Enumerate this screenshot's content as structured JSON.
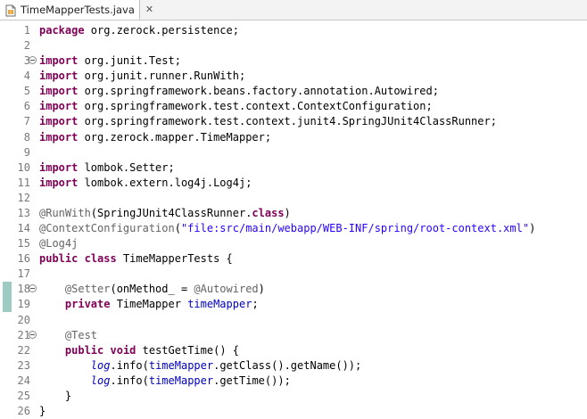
{
  "tab": {
    "title": "TimeMapperTests.java"
  },
  "lines": [
    {
      "n": "1",
      "tokens": [
        {
          "t": "package",
          "c": "kw"
        },
        {
          "t": " org.zerock.persistence;"
        }
      ]
    },
    {
      "n": "2",
      "tokens": []
    },
    {
      "n": "3",
      "fold": true,
      "tokens": [
        {
          "t": "import",
          "c": "kw"
        },
        {
          "t": " org.junit.Test;"
        }
      ]
    },
    {
      "n": "4",
      "tokens": [
        {
          "t": "import",
          "c": "kw"
        },
        {
          "t": " org.junit.runner.RunWith;"
        }
      ]
    },
    {
      "n": "5",
      "tokens": [
        {
          "t": "import",
          "c": "kw"
        },
        {
          "t": " org.springframework.beans.factory.annotation.Autowired;"
        }
      ]
    },
    {
      "n": "6",
      "tokens": [
        {
          "t": "import",
          "c": "kw"
        },
        {
          "t": " org.springframework.test.context.ContextConfiguration;"
        }
      ]
    },
    {
      "n": "7",
      "tokens": [
        {
          "t": "import",
          "c": "kw"
        },
        {
          "t": " org.springframework.test.context.junit4.SpringJUnit4ClassRunner;"
        }
      ]
    },
    {
      "n": "8",
      "tokens": [
        {
          "t": "import",
          "c": "kw"
        },
        {
          "t": " org.zerock.mapper.TimeMapper;"
        }
      ]
    },
    {
      "n": "9",
      "tokens": []
    },
    {
      "n": "10",
      "tokens": [
        {
          "t": "import",
          "c": "kw"
        },
        {
          "t": " lombok.Setter;"
        }
      ]
    },
    {
      "n": "11",
      "tokens": [
        {
          "t": "import",
          "c": "kw"
        },
        {
          "t": " lombok.extern.log4j.Log4j;"
        }
      ]
    },
    {
      "n": "12",
      "tokens": []
    },
    {
      "n": "13",
      "tokens": [
        {
          "t": "@RunWith",
          "c": "ann"
        },
        {
          "t": "(SpringJUnit4ClassRunner."
        },
        {
          "t": "class",
          "c": "kw"
        },
        {
          "t": ")"
        }
      ]
    },
    {
      "n": "14",
      "tokens": [
        {
          "t": "@ContextConfiguration",
          "c": "ann"
        },
        {
          "t": "("
        },
        {
          "t": "\"file:src/main/webapp/WEB-INF/spring/root-context.xml\"",
          "c": "str"
        },
        {
          "t": ")"
        }
      ]
    },
    {
      "n": "15",
      "tokens": [
        {
          "t": "@Log4j",
          "c": "ann"
        }
      ]
    },
    {
      "n": "16",
      "tokens": [
        {
          "t": "public",
          "c": "kw"
        },
        {
          "t": " "
        },
        {
          "t": "class",
          "c": "kw"
        },
        {
          "t": " TimeMapperTests {"
        }
      ]
    },
    {
      "n": "17",
      "tokens": []
    },
    {
      "n": "18",
      "fold": true,
      "mark": true,
      "tokens": [
        {
          "t": "    "
        },
        {
          "t": "@Setter",
          "c": "ann"
        },
        {
          "t": "(onMethod_ = "
        },
        {
          "t": "@Autowired",
          "c": "ann"
        },
        {
          "t": ")"
        }
      ]
    },
    {
      "n": "19",
      "mark": true,
      "tokens": [
        {
          "t": "    "
        },
        {
          "t": "private",
          "c": "kw"
        },
        {
          "t": " TimeMapper "
        },
        {
          "t": "timeMapper",
          "c": "fld"
        },
        {
          "t": ";"
        }
      ]
    },
    {
      "n": "20",
      "tokens": []
    },
    {
      "n": "21",
      "fold": true,
      "tokens": [
        {
          "t": "    "
        },
        {
          "t": "@Test",
          "c": "ann"
        }
      ]
    },
    {
      "n": "22",
      "tokens": [
        {
          "t": "    "
        },
        {
          "t": "public",
          "c": "kw"
        },
        {
          "t": " "
        },
        {
          "t": "void",
          "c": "kw"
        },
        {
          "t": " testGetTime() {"
        }
      ]
    },
    {
      "n": "23",
      "tokens": [
        {
          "t": "        "
        },
        {
          "t": "log",
          "c": "sfld"
        },
        {
          "t": ".info("
        },
        {
          "t": "timeMapper",
          "c": "fld"
        },
        {
          "t": ".getClass().getName());"
        }
      ]
    },
    {
      "n": "24",
      "tokens": [
        {
          "t": "        "
        },
        {
          "t": "log",
          "c": "sfld"
        },
        {
          "t": ".info("
        },
        {
          "t": "timeMapper",
          "c": "fld"
        },
        {
          "t": ".getTime());"
        }
      ]
    },
    {
      "n": "25",
      "tokens": [
        {
          "t": "    }"
        }
      ]
    },
    {
      "n": "26",
      "tokens": [
        {
          "t": "}"
        }
      ]
    }
  ]
}
